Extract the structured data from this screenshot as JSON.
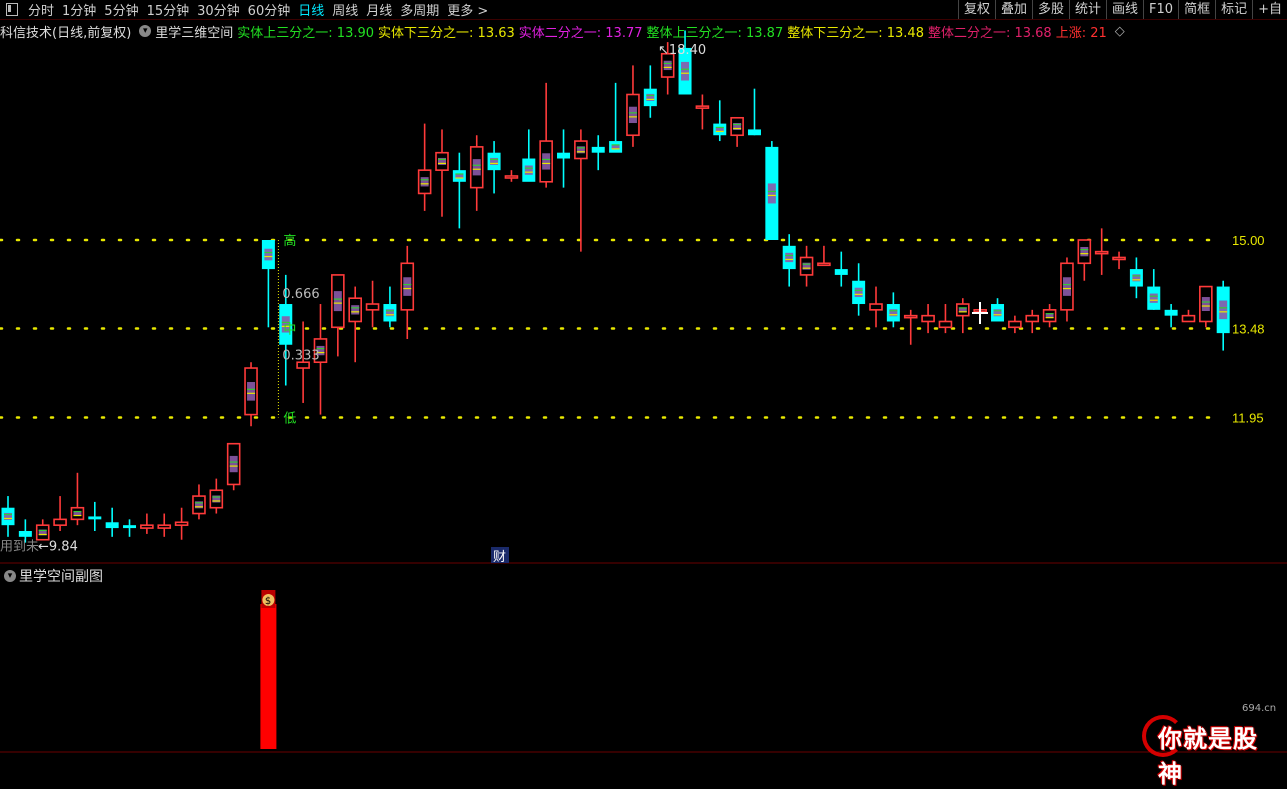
{
  "toolbar": {
    "periods": [
      "分时",
      "1分钟",
      "5分钟",
      "15分钟",
      "30分钟",
      "60分钟",
      "日线",
      "周线",
      "月线",
      "多周期",
      "更多 >"
    ],
    "active_period": "日线",
    "right_buttons": [
      "复权",
      "叠加",
      "多股",
      "统计",
      "画线",
      "F10",
      "简框",
      "标记",
      "+自"
    ]
  },
  "infobar": {
    "stock": "科信技术(日线,前复权)",
    "indicator": "里学三维空间",
    "items": [
      {
        "label": "实体上三分之一: 13.90",
        "color": "#22e022"
      },
      {
        "label": "实体下三分之一: 13.63",
        "color": "#e8e800"
      },
      {
        "label": "实体二分之一: 13.77",
        "color": "#e020e0"
      },
      {
        "label": "整体上三分之一: 13.87",
        "color": "#22e022"
      },
      {
        "label": "整体下三分之一: 13.48",
        "color": "#e8e800"
      },
      {
        "label": "整体二分之一: 13.68",
        "color": "#e0206a"
      },
      {
        "label": "上涨: 21",
        "color": "#ff3030"
      }
    ]
  },
  "price_labels": {
    "high": "15.00",
    "mid": "13.48",
    "low": "11.95"
  },
  "annotations": {
    "max_price": "18.40",
    "min_price": "9.84",
    "gao": "高",
    "zhong": "中",
    "di": "低",
    "r666": "0.666",
    "r333": "0.333",
    "cai": "财",
    "bottom_left": "用到未"
  },
  "sub_chart": {
    "title": "里学空间副图",
    "bag_icon": "$"
  },
  "watermark": {
    "text": "你就是股神",
    "site": "694.cn"
  },
  "colors": {
    "up": "#ff3a3a",
    "down": "#00ffff",
    "dot": "#e8e800",
    "bar": "#ff0000",
    "background": "#000000"
  },
  "chart_data": {
    "type": "candlestick",
    "ohlc": [
      [
        10.4,
        10.6,
        9.9,
        10.1
      ],
      [
        10.0,
        10.2,
        9.8,
        9.9
      ],
      [
        9.85,
        10.2,
        9.84,
        10.1
      ],
      [
        10.1,
        10.6,
        10.0,
        10.2
      ],
      [
        10.2,
        11.0,
        10.1,
        10.4
      ],
      [
        10.25,
        10.5,
        10.0,
        10.2
      ],
      [
        10.15,
        10.4,
        9.9,
        10.05
      ],
      [
        10.1,
        10.2,
        9.9,
        10.05
      ],
      [
        10.05,
        10.3,
        9.95,
        10.1
      ],
      [
        10.05,
        10.3,
        9.9,
        10.1
      ],
      [
        10.1,
        10.4,
        9.85,
        10.15
      ],
      [
        10.3,
        10.8,
        10.2,
        10.6
      ],
      [
        10.4,
        10.9,
        10.3,
        10.7
      ],
      [
        10.8,
        11.5,
        10.7,
        11.5
      ],
      [
        12.0,
        12.9,
        11.8,
        12.8
      ],
      [
        15.0,
        15.0,
        13.5,
        14.5
      ],
      [
        13.9,
        14.4,
        12.5,
        13.2
      ],
      [
        12.8,
        13.6,
        12.2,
        12.9
      ],
      [
        12.9,
        13.9,
        12.0,
        13.3
      ],
      [
        13.5,
        14.2,
        13.0,
        14.4
      ],
      [
        13.6,
        14.2,
        12.9,
        14.0
      ],
      [
        13.8,
        14.3,
        13.5,
        13.9
      ],
      [
        13.9,
        14.2,
        13.5,
        13.6
      ],
      [
        13.8,
        14.9,
        13.3,
        14.6
      ],
      [
        15.8,
        17.0,
        15.5,
        16.2
      ],
      [
        16.2,
        16.9,
        15.4,
        16.5
      ],
      [
        16.2,
        16.5,
        15.2,
        16.0
      ],
      [
        15.9,
        16.8,
        15.5,
        16.6
      ],
      [
        16.5,
        16.7,
        15.8,
        16.2
      ],
      [
        16.1,
        16.2,
        16.0,
        16.1
      ],
      [
        16.4,
        16.9,
        16.1,
        16.0
      ],
      [
        16.0,
        17.7,
        15.9,
        16.7
      ],
      [
        16.5,
        16.9,
        15.9,
        16.4
      ],
      [
        16.4,
        16.9,
        14.8,
        16.7
      ],
      [
        16.6,
        16.8,
        16.2,
        16.5
      ],
      [
        16.7,
        17.7,
        16.7,
        16.5
      ],
      [
        16.8,
        18.0,
        16.6,
        17.5
      ],
      [
        17.6,
        18.0,
        17.1,
        17.3
      ],
      [
        17.8,
        18.4,
        17.5,
        18.2
      ],
      [
        18.3,
        18.6,
        17.6,
        17.5
      ],
      [
        17.3,
        17.5,
        16.9,
        17.3
      ],
      [
        17.0,
        17.4,
        16.7,
        16.8
      ],
      [
        16.8,
        17.1,
        16.6,
        17.1
      ],
      [
        16.9,
        17.6,
        16.8,
        16.8
      ],
      [
        16.6,
        16.7,
        15.0,
        15.0
      ],
      [
        14.9,
        15.1,
        14.2,
        14.5
      ],
      [
        14.4,
        14.9,
        14.2,
        14.7
      ],
      [
        14.6,
        14.9,
        14.6,
        14.6
      ],
      [
        14.5,
        14.8,
        14.2,
        14.4
      ],
      [
        14.3,
        14.6,
        13.7,
        13.9
      ],
      [
        13.8,
        14.2,
        13.5,
        13.9
      ],
      [
        13.9,
        14.1,
        13.5,
        13.6
      ],
      [
        13.7,
        13.8,
        13.2,
        13.7
      ],
      [
        13.6,
        13.9,
        13.4,
        13.7
      ],
      [
        13.5,
        13.9,
        13.4,
        13.6
      ],
      [
        13.7,
        14.0,
        13.4,
        13.9
      ],
      [
        13.8,
        13.9,
        13.7,
        13.8
      ],
      [
        13.9,
        14.0,
        13.7,
        13.6
      ],
      [
        13.5,
        13.7,
        13.4,
        13.6
      ],
      [
        13.6,
        13.8,
        13.4,
        13.7
      ],
      [
        13.6,
        13.9,
        13.5,
        13.8
      ],
      [
        13.8,
        14.7,
        13.6,
        14.6
      ],
      [
        14.6,
        15.0,
        14.3,
        15.0
      ],
      [
        14.8,
        15.2,
        14.4,
        14.8
      ],
      [
        14.7,
        14.8,
        14.5,
        14.7
      ],
      [
        14.5,
        14.7,
        14.0,
        14.2
      ],
      [
        14.2,
        14.5,
        13.8,
        13.8
      ],
      [
        13.8,
        13.9,
        13.5,
        13.7
      ],
      [
        13.6,
        13.8,
        13.6,
        13.7
      ],
      [
        13.6,
        14.2,
        13.5,
        14.2
      ],
      [
        14.2,
        14.3,
        13.1,
        13.4
      ]
    ],
    "guides": {
      "high": 15.0,
      "mid": 13.48,
      "low": 11.95
    },
    "sub_bar": {
      "index": 15
    }
  }
}
